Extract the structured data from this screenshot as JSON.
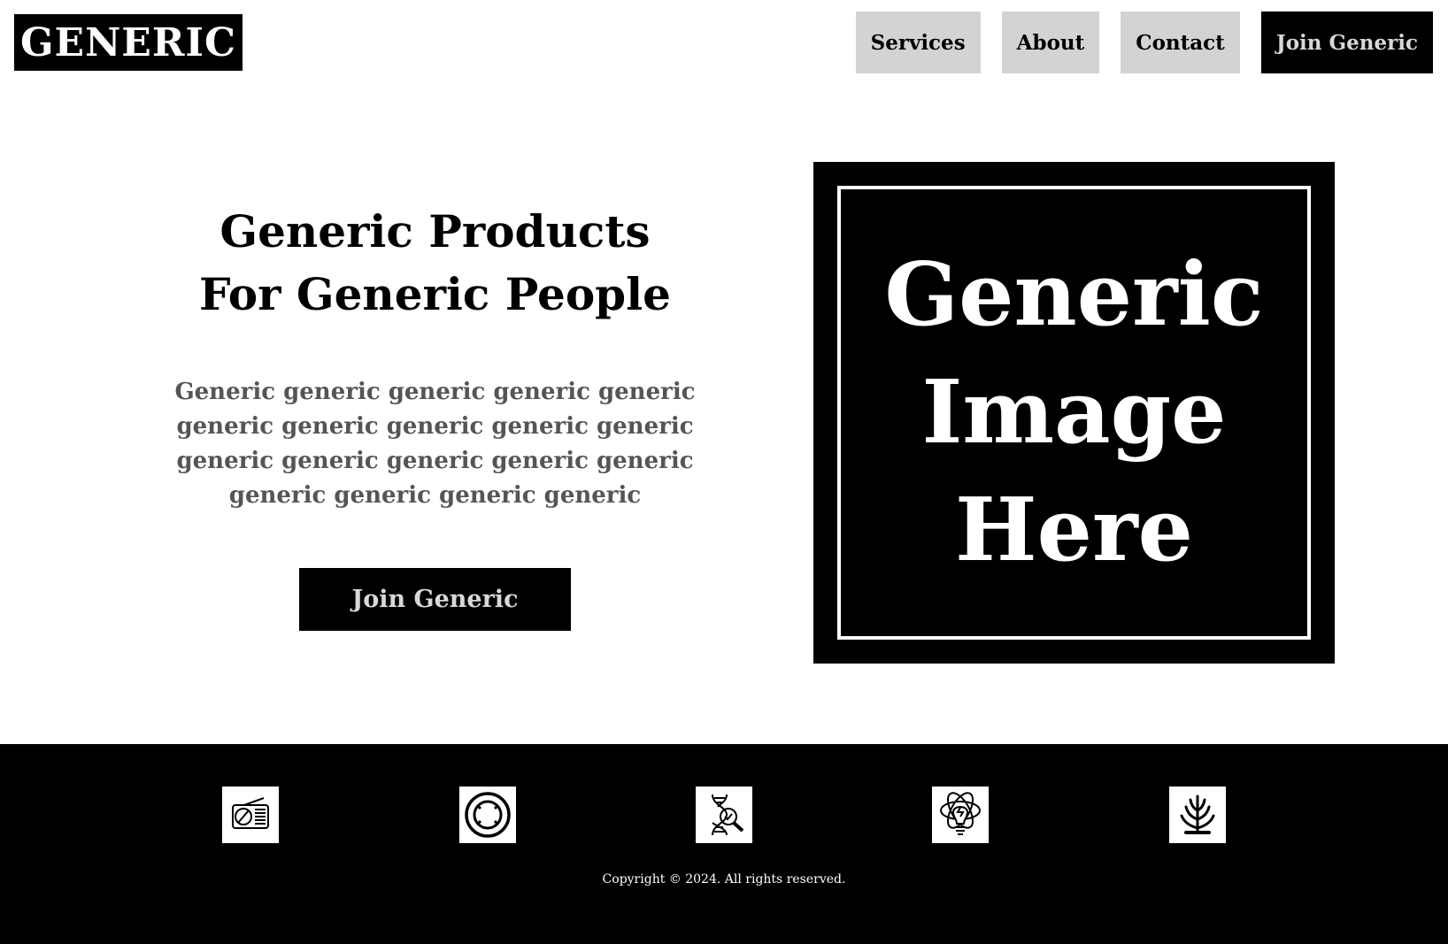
{
  "header": {
    "logo": "GENERIC",
    "nav": [
      "Services",
      "About",
      "Contact"
    ],
    "cta": "Join Generic"
  },
  "hero": {
    "title_line1": "Generic Products",
    "title_line2": "For Generic People",
    "body_line1": "Generic generic generic generic generic",
    "body_line2": "generic generic generic generic generic",
    "body_line3": "generic generic generic generic generic",
    "body_line4": "generic generic generic generic",
    "cta": "Join Generic"
  },
  "image_placeholder": {
    "line1": "Generic",
    "line2": "Image",
    "line3": "Here"
  },
  "footer": {
    "icons": [
      "radio-icon",
      "ring-icon",
      "dna-search-icon",
      "lightbulb-atom-icon",
      "plant-icon"
    ],
    "copyright": "Copyright © 2024. All rights reserved."
  },
  "colors": {
    "primary": "#000000",
    "nav_bg": "#d3d3d3",
    "body_text": "#555555",
    "button_text": "#d8d8d8"
  }
}
